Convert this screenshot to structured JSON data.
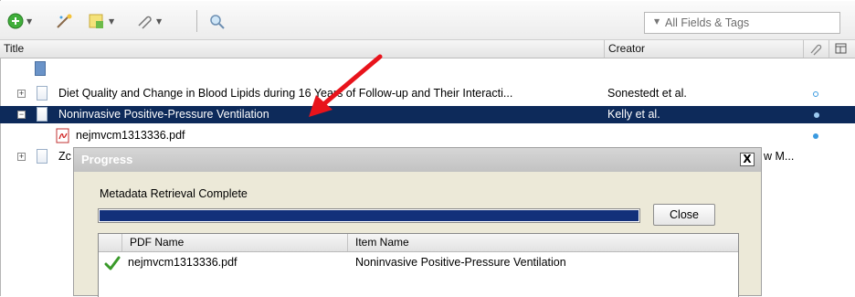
{
  "toolbar": {
    "new_item_icon": "plus-circle-icon",
    "new_note_icon": "magic-wand-icon",
    "add_attachment_icon": "note-icon",
    "paperclip_icon": "paperclip-icon",
    "locate_icon": "magnifier-icon"
  },
  "search": {
    "placeholder": "All Fields & Tags"
  },
  "columns": {
    "title": "Title",
    "creator": "Creator"
  },
  "rows": [
    {
      "title": "",
      "creator": ""
    },
    {
      "title": "Diet Quality and Change in Blood Lipids during 16 Years of Follow-up and Their Interacti...",
      "creator": "Sonestedt et al."
    },
    {
      "title": "Noninvasive Positive-Pressure Ventilation",
      "creator": "Kelly et al."
    },
    {
      "title": "nejmvcm1313336.pdf",
      "creator": ""
    },
    {
      "title": "Zc",
      "creator": "w M..."
    }
  ],
  "dialog": {
    "title": "Progress",
    "close_glyph": "X",
    "status": "Metadata Retrieval Complete",
    "progress": 1.0,
    "close_label": "Close",
    "list_headers": {
      "pdf_name": "PDF Name",
      "item_name": "Item Name"
    },
    "list_rows": [
      {
        "pdf_name": "nejmvcm1313336.pdf",
        "item_name": "Noninvasive Positive-Pressure Ventilation"
      }
    ]
  },
  "colors": {
    "selection": "#0d2a5a",
    "progress": "#13307a",
    "annotation_arrow": "#e8131b",
    "dot": "#3a9ae0"
  }
}
